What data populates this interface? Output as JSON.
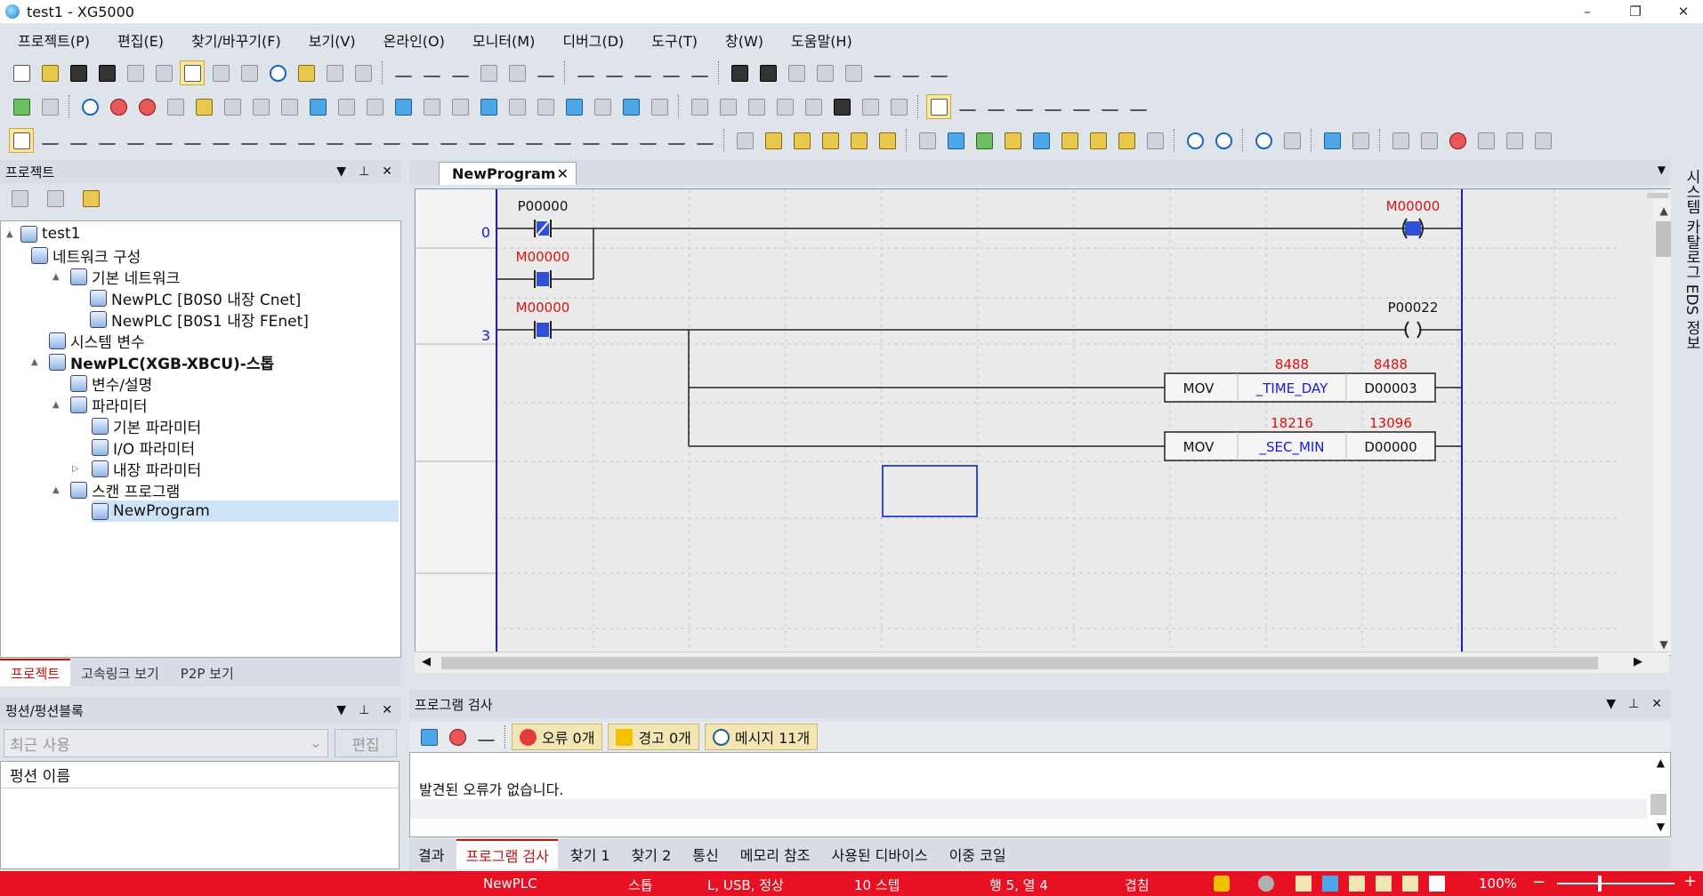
{
  "window": {
    "title": "test1 - XG5000",
    "minimize": "–",
    "restore": "❐",
    "close": "✕"
  },
  "menu": [
    "프로젝트(P)",
    "편집(E)",
    "찾기/바꾸기(F)",
    "보기(V)",
    "온라인(O)",
    "모니터(M)",
    "디버그(D)",
    "도구(T)",
    "창(W)",
    "도움말(H)"
  ],
  "toolbar2_keys": [
    "F3",
    "F4",
    "F5",
    "F6",
    "F7",
    "F8",
    "F9"
  ],
  "toolbar3_keys": [
    "Esc",
    "F3",
    "F4",
    "sF1",
    "csA",
    "sF2",
    "csS",
    "aR",
    "aF",
    "F5",
    "F6",
    "sF8",
    "sF9",
    "F9",
    "F11",
    "sF3",
    "sF4",
    "sF5",
    "sF6",
    "F10",
    "sF7",
    "c3",
    "c4",
    "c5",
    "c6"
  ],
  "project_panel": {
    "title": "프로젝트",
    "controls": {
      "dropdown": "▼",
      "pin": "📌",
      "close": "✕"
    },
    "tree": [
      {
        "label": "test1",
        "level": 0
      },
      {
        "label": "네트워크 구성",
        "level": 1
      },
      {
        "label": "기본 네트워크",
        "level": 2
      },
      {
        "label": "NewPLC [B0S0 내장 Cnet]",
        "level": 3
      },
      {
        "label": "NewPLC [B0S1 내장 FEnet]",
        "level": 3
      },
      {
        "label": "시스템 변수",
        "level": 1
      },
      {
        "label": "NewPLC(XGB-XBCU)-스톱",
        "level": 1
      },
      {
        "label": "변수/설명",
        "level": 2
      },
      {
        "label": "파라미터",
        "level": 2
      },
      {
        "label": "기본 파라미터",
        "level": 3
      },
      {
        "label": "I/O 파라미터",
        "level": 3
      },
      {
        "label": "내장 파라미터",
        "level": 3
      },
      {
        "label": "스캔 프로그램",
        "level": 2
      },
      {
        "label": "NewProgram",
        "level": 3
      }
    ],
    "tabs": [
      "프로젝트",
      "고속링크 보기",
      "P2P 보기"
    ]
  },
  "function_panel": {
    "title": "펑션/펑션블록",
    "recent": "최근 사용",
    "edit": "편집",
    "column": "펑션 이름"
  },
  "editor": {
    "tab": "NewProgram",
    "tab_close": "✕",
    "rungs": [
      {
        "step": "0"
      },
      {
        "step": "3"
      }
    ],
    "labels": {
      "c1": "P00000",
      "c2": "M00000",
      "c3": "M00000",
      "out1": "M00000",
      "out2": "P00022",
      "mov": "MOV",
      "s1": "_TIME_DAY",
      "d1": "D00003",
      "s2": "_SEC_MIN",
      "d2": "D00000",
      "v1": "8488",
      "v2": "8488",
      "v3": "18216",
      "v4": "13096"
    }
  },
  "check_panel": {
    "title": "프로그램 검사",
    "errors": "오류 0개",
    "warnings": "경고 0개",
    "messages": "메시지 11개",
    "output": "발견된 오류가 없습니다.",
    "tabs": [
      "결과",
      "프로그램 검사",
      "찾기 1",
      "찾기 2",
      "통신",
      "메모리 참조",
      "사용된 디바이스",
      "이중 코일"
    ]
  },
  "right_strip": "시스템 카탈로그  EDS 정보",
  "status": {
    "plc": "NewPLC",
    "mode": "스톱",
    "conn": "L, USB, 정상",
    "steps": "10 스텝",
    "pos": "행 5, 열 4",
    "overwrite": "겹침",
    "zoom": "100%",
    "minus": "−",
    "plus": "+"
  },
  "colors": {
    "status_bar": "#e81123",
    "rail": "#1a1adb",
    "contact": "#2e4fd6",
    "value_red": "#e01010",
    "label_blue": "#1a1adb"
  }
}
